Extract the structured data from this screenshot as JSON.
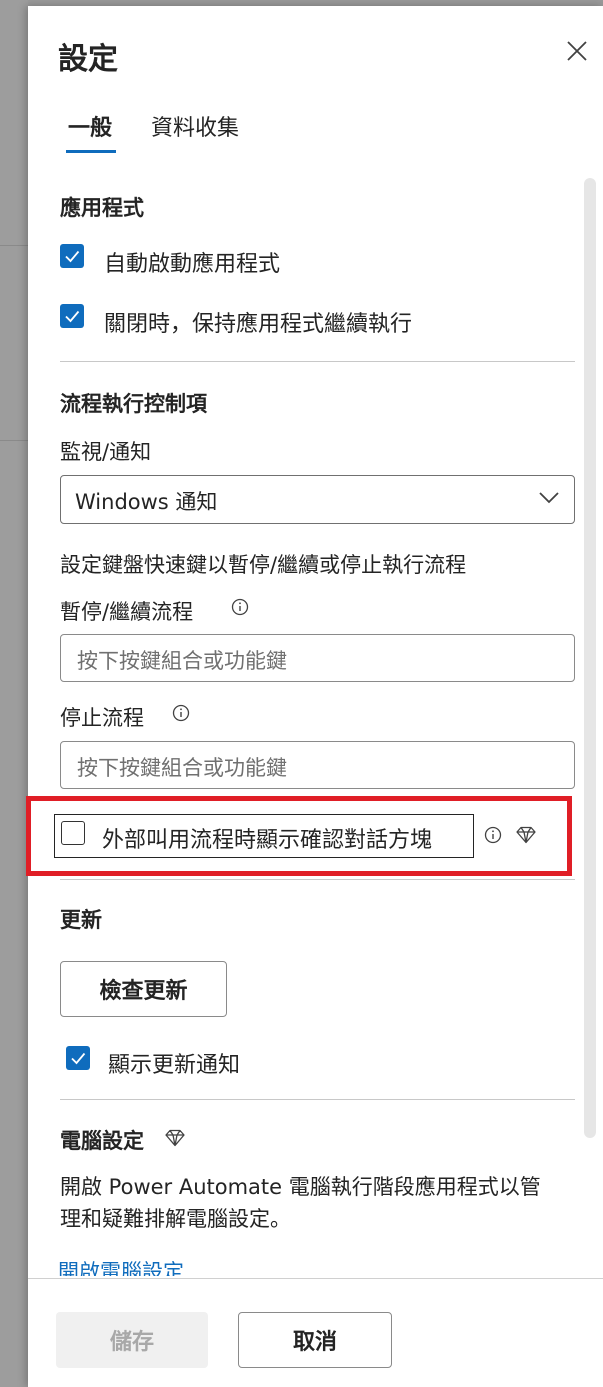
{
  "panel": {
    "title": "設定",
    "tabs": [
      {
        "label": "一般",
        "active": true
      },
      {
        "label": "資料收集",
        "active": false
      }
    ]
  },
  "app_section": {
    "heading": "應用程式",
    "options": [
      {
        "label": "自動啟動應用程式",
        "checked": true
      },
      {
        "label": "關閉時，保持應用程式繼續執行",
        "checked": true
      }
    ]
  },
  "flow_section": {
    "heading": "流程執行控制項",
    "monitor_label": "監視/通知",
    "monitor_value": "Windows 通知",
    "shortcut_desc": "設定鍵盤快速鍵以暫停/繼續或停止執行流程",
    "pause_label": "暫停/繼續流程",
    "pause_placeholder": "按下按鍵組合或功能鍵",
    "stop_label": "停止流程",
    "stop_placeholder": "按下按鍵組合或功能鍵",
    "confirm_dialog_label": "外部叫用流程時顯示確認對話方塊",
    "confirm_dialog_checked": false
  },
  "update_section": {
    "heading": "更新",
    "check_button": "檢查更新",
    "notify_label": "顯示更新通知",
    "notify_checked": true
  },
  "machine_section": {
    "heading": "電腦設定",
    "description": "開啟 Power Automate 電腦執行階段應用程式以管理和疑難排解電腦設定。",
    "link": "開啟電腦設定"
  },
  "footer": {
    "save_label": "儲存",
    "cancel_label": "取消"
  },
  "colors": {
    "accent": "#0f6cbd",
    "highlight": "#e01e26"
  }
}
